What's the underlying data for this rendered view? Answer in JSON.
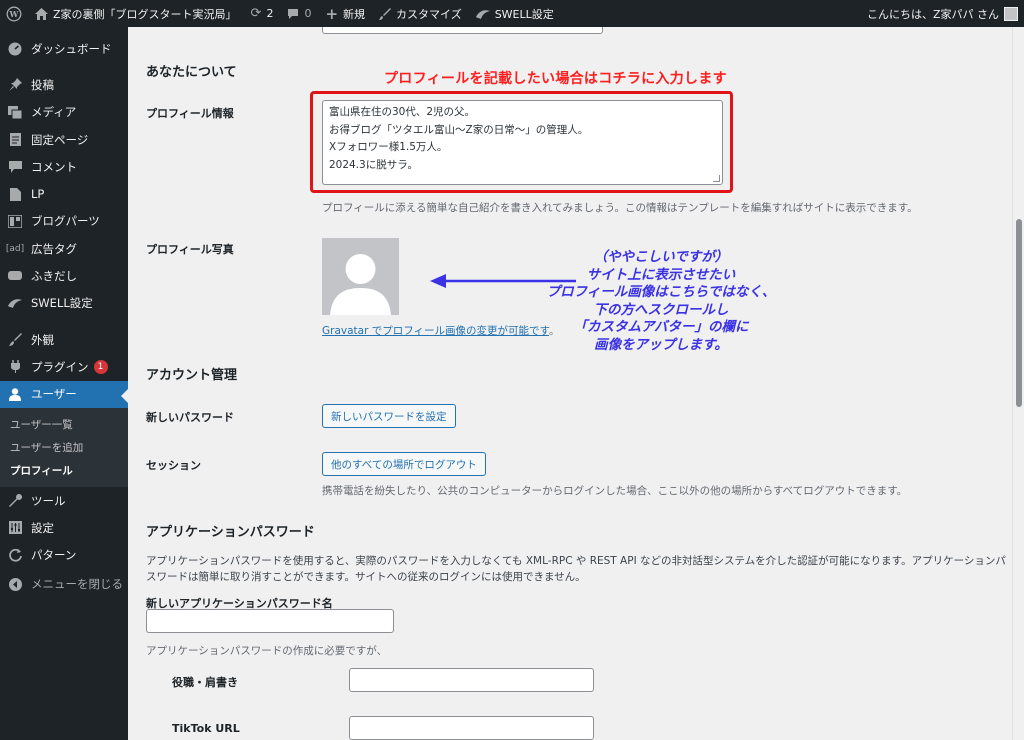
{
  "adminbar": {
    "site_name": "Z家の裏側「ブログスタート実況局」",
    "updates_count": "2",
    "comments_count": "0",
    "new_label": "新規",
    "customize_label": "カスタマイズ",
    "swell_label": "SWELL設定",
    "greeting": "こんにちは、Z家パパ さん"
  },
  "sidebar": {
    "dashboard": "ダッシュボード",
    "posts": "投稿",
    "media": "メディア",
    "pages": "固定ページ",
    "comments": "コメント",
    "lp": "LP",
    "blog_parts": "ブログパーツ",
    "ad_tag_icon_text": "[ad]",
    "ad_tags": "広告タグ",
    "balloon": "ふきだし",
    "swell_settings": "SWELL設定",
    "appearance": "外観",
    "plugins": "プラグイン",
    "plugins_badge": "1",
    "users": "ユーザー",
    "sub_users_list": "ユーザー一覧",
    "sub_add_user": "ユーザーを追加",
    "sub_profile": "プロフィール",
    "tools": "ツール",
    "settings": "設定",
    "patterns": "パターン",
    "collapse_menu": "メニューを閉じる"
  },
  "about": {
    "heading": "あなたについて",
    "bio_label": "プロフィール情報",
    "bio_lines": [
      "富山県在住の30代、2児の父。",
      "お得ブログ「ツタエル富山〜Z家の日常〜」の管理人。",
      "Xフォロワー様1.5万人。",
      "2024.3に脱サラ。"
    ],
    "bio_desc": "プロフィールに添える簡単な自己紹介を書き入れてみましょう。この情報はテンプレートを編集すればサイトに表示できます。",
    "photo_label": "プロフィール写真",
    "gravatar_link": "Gravatar でプロフィール画像の変更が可能です",
    "gravatar_suffix": "。"
  },
  "annotations": {
    "red_note": "プロフィールを記載したい場合はコチラに入力します",
    "blue_note_lines": [
      "（ややこしいですが）",
      "サイト上に表示させたい",
      "プロフィール画像はこちらではなく、",
      "下の方へスクロールし",
      "「カスタムアバター」の欄に",
      "画像をアップします。"
    ]
  },
  "account": {
    "heading": "アカウント管理",
    "new_password_label": "新しいパスワード",
    "set_password_button": "新しいパスワードを設定",
    "session_label": "セッション",
    "logout_everywhere_button": "他のすべての場所でログアウト",
    "session_desc": "携帯電話を紛失したり、公共のコンピューターからログインした場合、ここ以外の他の場所からすべてログアウトできます。"
  },
  "app_passwords": {
    "heading": "アプリケーションパスワード",
    "desc_line1": "アプリケーションパスワードを使用すると、実際のパスワードを入力しなくても XML-RPC や REST API などの非対話型システムを介した認証が可能になります。アプリケーションパ",
    "desc_line2": "スワードは簡単に取り消すことができます。サイトへの従来のログインには使用できません。",
    "new_name_label": "新しいアプリケーションパスワード名",
    "name_value": "",
    "required_note": "アプリケーションパスワードの作成に必要ですが、"
  },
  "extra_fields": {
    "job_title_label": "役職・肩書き",
    "job_title_value": "",
    "tiktok_label": "TikTok URL",
    "tiktok_value": ""
  },
  "colors": {
    "accent": "#2271b1",
    "admin_dark": "#1d2327",
    "annotation_red": "#ff1e1e",
    "annotation_blue": "#3a32e4",
    "badge_red": "#d63638"
  }
}
